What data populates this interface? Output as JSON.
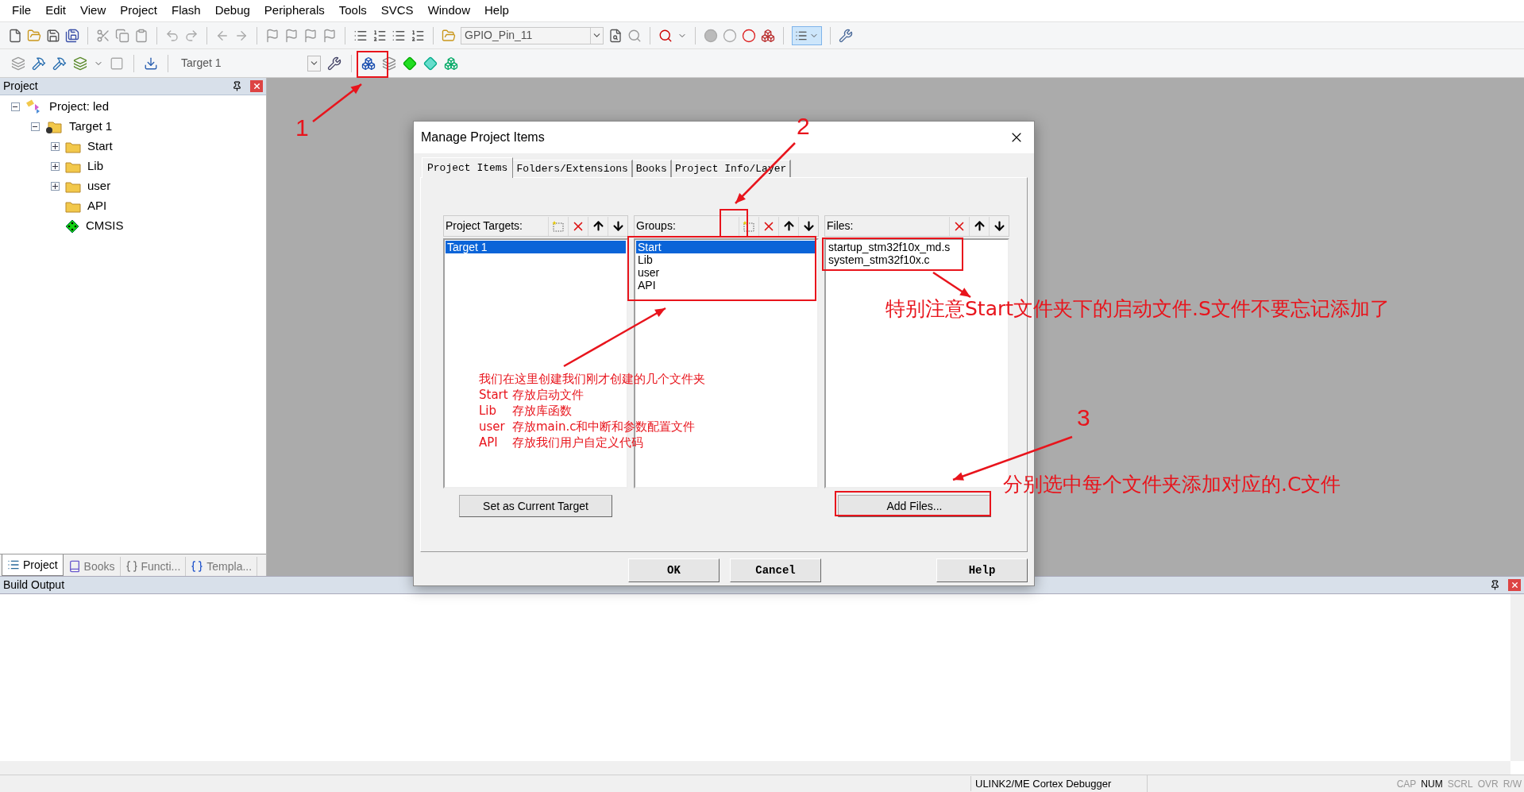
{
  "menu": [
    "File",
    "Edit",
    "View",
    "Project",
    "Flash",
    "Debug",
    "Peripherals",
    "Tools",
    "SVCS",
    "Window",
    "Help"
  ],
  "toolbar": {
    "find_text": "GPIO_Pin_11",
    "target": "Target 1"
  },
  "project_panel": {
    "title": "Project",
    "tree": [
      {
        "label": "Project: led",
        "kind": "project",
        "expanded": true,
        "children": [
          {
            "label": "Target 1",
            "kind": "target",
            "expanded": true,
            "children": [
              {
                "label": "Start",
                "kind": "group",
                "expanded": false
              },
              {
                "label": "Lib",
                "kind": "group",
                "expanded": false
              },
              {
                "label": "user",
                "kind": "group",
                "expanded": false
              },
              {
                "label": "API",
                "kind": "group"
              },
              {
                "label": "CMSIS",
                "kind": "component"
              }
            ]
          }
        ]
      }
    ],
    "tabs": [
      {
        "label": "Project",
        "kind": "project",
        "selected": true
      },
      {
        "label": "Books",
        "kind": "books",
        "selected": false
      },
      {
        "label": "Functi...",
        "kind": "functions",
        "selected": false
      },
      {
        "label": "Templa...",
        "kind": "templates",
        "selected": false
      }
    ]
  },
  "build_output": {
    "title": "Build Output"
  },
  "status_bar": {
    "debugger": "ULINK2/ME Cortex Debugger",
    "indicators": [
      {
        "label": "CAP",
        "on": false
      },
      {
        "label": "NUM",
        "on": true
      },
      {
        "label": "SCRL",
        "on": false
      },
      {
        "label": "OVR",
        "on": false
      },
      {
        "label": "R/W",
        "on": false
      }
    ]
  },
  "dialog": {
    "title": "Manage Project Items",
    "tabs": [
      {
        "label": "Project Items",
        "selected": true
      },
      {
        "label": "Folders/Extensions",
        "selected": false
      },
      {
        "label": "Books",
        "selected": false
      },
      {
        "label": "Project Info/Layer",
        "selected": false
      }
    ],
    "panes": [
      {
        "title": "Project Targets:",
        "tools": [
          {
            "kind": "new"
          },
          {
            "kind": "delete"
          },
          {
            "kind": "up"
          },
          {
            "kind": "down"
          }
        ],
        "items": [
          {
            "label": "Target 1",
            "selected": true
          }
        ],
        "button": "Set as Current Target"
      },
      {
        "title": "Groups:",
        "tools": [
          {
            "kind": "new"
          },
          {
            "kind": "delete"
          },
          {
            "kind": "up"
          },
          {
            "kind": "down"
          }
        ],
        "items": [
          {
            "label": "Start",
            "selected": true
          },
          {
            "label": "Lib",
            "selected": false
          },
          {
            "label": "user",
            "selected": false
          },
          {
            "label": "API",
            "selected": false
          }
        ]
      },
      {
        "title": "Files:",
        "tools": [
          {
            "kind": "delete"
          },
          {
            "kind": "up"
          },
          {
            "kind": "down"
          }
        ],
        "items": [
          {
            "label": "startup_stm32f10x_md.s",
            "selected": false
          },
          {
            "label": "system_stm32f10x.c",
            "selected": false
          }
        ],
        "button": "Add Files..."
      }
    ],
    "buttons": [
      "OK",
      "Cancel",
      "Help"
    ]
  },
  "annotations": {
    "numbers": [
      "1",
      "2",
      "3"
    ],
    "notes": [
      "特别注意Start文件夹下的启动文件.S文件不要忘记添加了",
      "分别选中每个文件夹添加对应的.C文件"
    ],
    "folder_note": {
      "heading": "我们在这里创建我们刚才创建的几个文件夹",
      "rows": [
        {
          "folder": "Start",
          "purpose": "存放启动文件"
        },
        {
          "folder": "Lib",
          "purpose": "存放库函数"
        },
        {
          "folder": "user",
          "purpose": "存放main.c和中断和参数配置文件"
        },
        {
          "folder": "API",
          "purpose": "存放我们用户自定义代码"
        }
      ]
    }
  }
}
